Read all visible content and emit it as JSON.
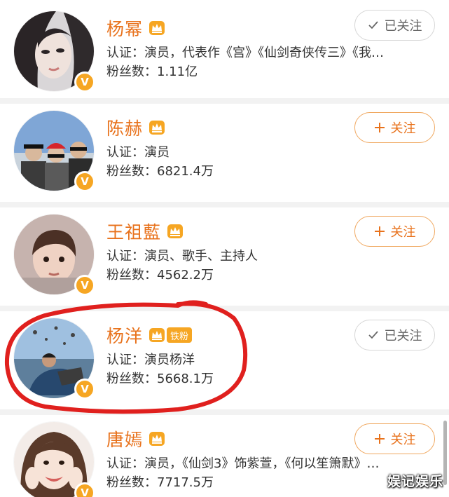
{
  "users": [
    {
      "name": "杨幂",
      "verify_label": "认证：",
      "verify_text": "演员，代表作《宫》《仙剑奇侠传三》《我…",
      "fans_label": "粉丝数：",
      "fans_value": "1.11亿",
      "button_label": "已关注",
      "button_state": "following",
      "fan_badge": ""
    },
    {
      "name": "陈赫",
      "verify_label": "认证：",
      "verify_text": "演员",
      "fans_label": "粉丝数：",
      "fans_value": "6821.4万",
      "button_label": "关注",
      "button_state": "follow",
      "fan_badge": ""
    },
    {
      "name": "王祖藍",
      "verify_label": "认证：",
      "verify_text": "演员、歌手、主持人",
      "fans_label": "粉丝数：",
      "fans_value": "4562.2万",
      "button_label": "关注",
      "button_state": "follow",
      "fan_badge": ""
    },
    {
      "name": "杨洋",
      "verify_label": "认证：",
      "verify_text": "演员杨洋",
      "fans_label": "粉丝数：",
      "fans_value": "5668.1万",
      "button_label": "已关注",
      "button_state": "following",
      "fan_badge": "铁粉"
    },
    {
      "name": "唐嫣",
      "verify_label": "认证：",
      "verify_text": "演员，《仙剑3》饰紫萱，《何以笙箫默》…",
      "fans_label": "粉丝数：",
      "fans_value": "7717.5万",
      "button_label": "关注",
      "button_state": "follow",
      "fan_badge": ""
    }
  ],
  "verify_badge_letter": "V",
  "watermark": "娱记娱乐",
  "colors": {
    "name": "#e8721c",
    "badge": "#f6a623",
    "highlight": "#e0201e"
  }
}
